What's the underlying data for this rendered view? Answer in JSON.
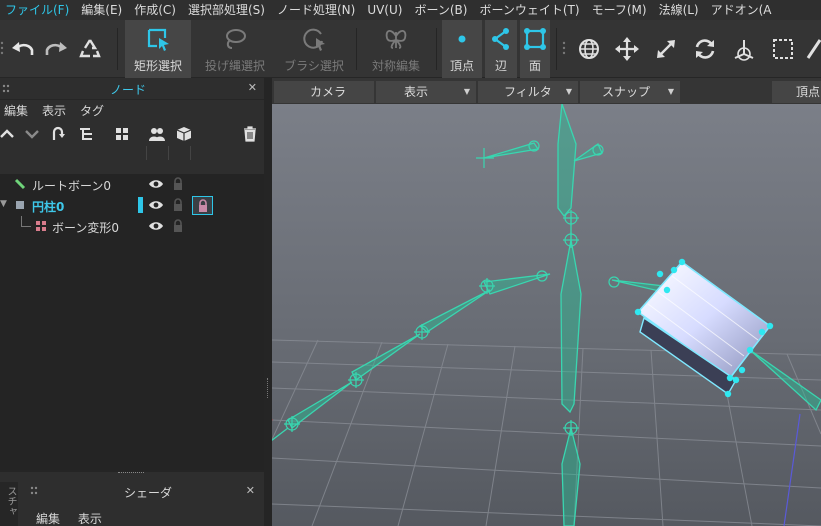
{
  "menu": [
    "ファイル(F)",
    "編集(E)",
    "作成(C)",
    "選択部処理(S)",
    "ノード処理(N)",
    "UV(U)",
    "ボーン(B)",
    "ボーンウェイト(T)",
    "モーフ(M)",
    "法線(L)",
    "アドオン(A"
  ],
  "toolbar": {
    "rect_select": "矩形選択",
    "lasso_select": "投げ縄選択",
    "brush_select": "ブラシ選択",
    "symmetry_edit": "対称編集",
    "vertex": "頂点",
    "edge": "辺",
    "face": "面"
  },
  "node_panel": {
    "title": "ノード",
    "submenu": [
      "編集",
      "表示",
      "タグ"
    ],
    "items": [
      {
        "label": "ルートボーン0"
      },
      {
        "label": "円柱0"
      },
      {
        "label": "ボーン変形0"
      }
    ]
  },
  "shader_panel": {
    "title": "シェーダ",
    "submenu": [
      "編集",
      "表示"
    ],
    "side_tab": "スチャ"
  },
  "view_header": {
    "camera": "カメラ",
    "display": "表示",
    "filter": "フィルタ",
    "snap": "スナップ",
    "vertex": "頂点"
  },
  "colors": {
    "accent": "#2ec6e8",
    "bone": "#39d6b0",
    "selection": "#7fe8ff"
  }
}
